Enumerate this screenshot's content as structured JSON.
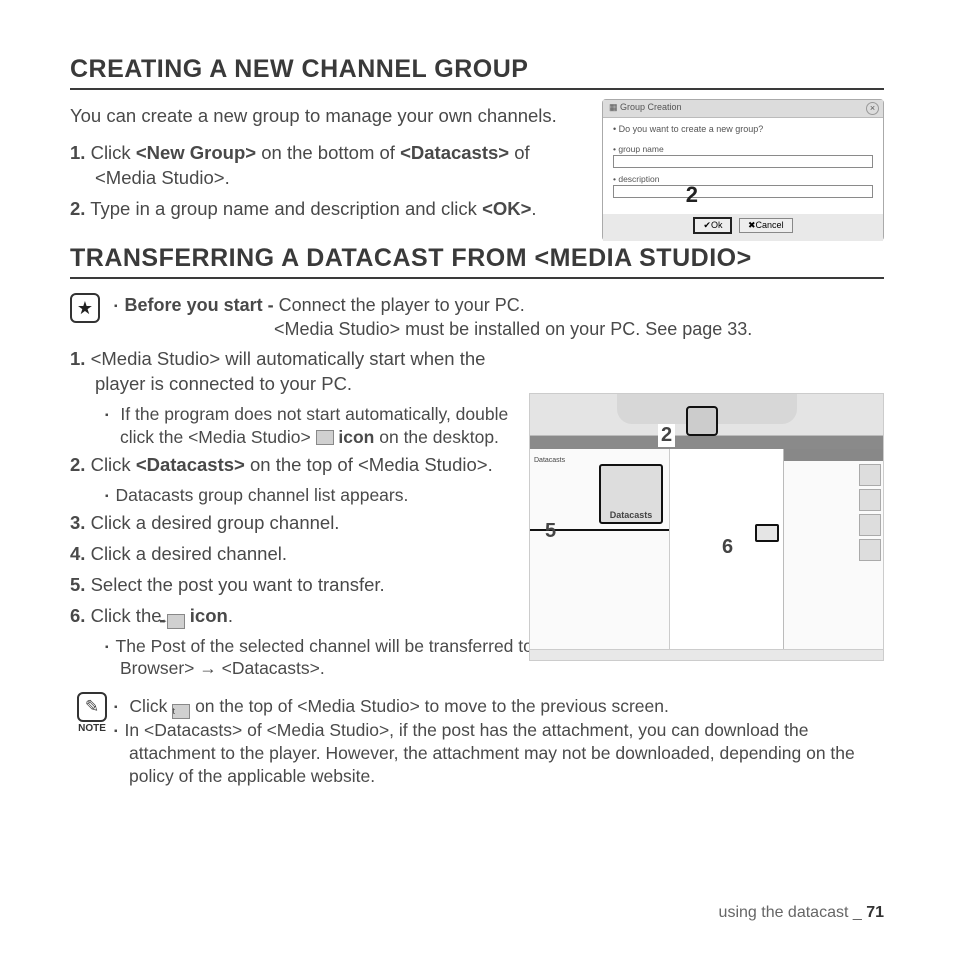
{
  "heading1": "CREATING A NEW CHANNEL GROUP",
  "intro1": "You can create a new group to manage your own channels.",
  "s1_1_a": "1.",
  "s1_1_b": " Click ",
  "s1_1_c": "<New Group>",
  "s1_1_d": " on the bottom of ",
  "s1_1_e": "<Datacasts>",
  "s1_1_f": " of <Media Studio>.",
  "s1_2_a": "2.",
  "s1_2_b": " Type in a group name and description and click ",
  "s1_2_c": "<OK>",
  "s1_2_d": ".",
  "dialog": {
    "title": "Group Creation",
    "question": "• Do you want to create a new group?",
    "lbl_name": "• group name",
    "lbl_desc": "• description",
    "ok": "Ok",
    "cancel": "Cancel"
  },
  "callout2": "2",
  "heading2": "TRANSFERRING A DATACAST FROM <MEDIA STUDIO>",
  "before_a": "Before you start - ",
  "before_b": "Connect the player to your PC.",
  "before_c": "<Media Studio> must be installed on your PC. See page 33.",
  "s2_1_a": "1.",
  "s2_1_b": " <Media Studio> will automatically start when the player is connected to your PC.",
  "s2_1_sub_a": "If the program does not start automatically, double click the <Media Studio> ",
  "s2_1_sub_b": " icon",
  "s2_1_sub_c": " on the desktop.",
  "s2_2_a": "2.",
  "s2_2_b": " Click ",
  "s2_2_c": "<Datacasts>",
  "s2_2_d": " on the top of <Media Studio>.",
  "s2_2_sub": "Datacasts group channel list appears.",
  "s2_3_a": "3.",
  "s2_3_b": " Click a desired group channel.",
  "s2_4_a": "4.",
  "s2_4_b": " Click a desired channel.",
  "s2_5_a": "5.",
  "s2_5_b": " Select the post you want to transfer.",
  "s2_6_a": "6.",
  "s2_6_b": " Click the ",
  "s2_6_c": " icon",
  "s2_6_d": ".",
  "s2_6_sub": "The Post of the selected channel will be transferred to the player in <Prime Pack> → <File Browser> → <Datacasts>.",
  "ms_label": "Datacasts",
  "callout5": "5",
  "callout6": "6",
  "note_lbl": "NOTE",
  "note1_a": "Click ",
  "note1_b": " on the top of <Media Studio> to move to the previous screen.",
  "note2": "In <Datacasts> of <Media Studio>, if the post has the attachment, you can download the attachment to the player. However, the attachment may not be downloaded, depending on the policy of the applicable website.",
  "footer_a": "using the datacast _ ",
  "footer_b": "71"
}
